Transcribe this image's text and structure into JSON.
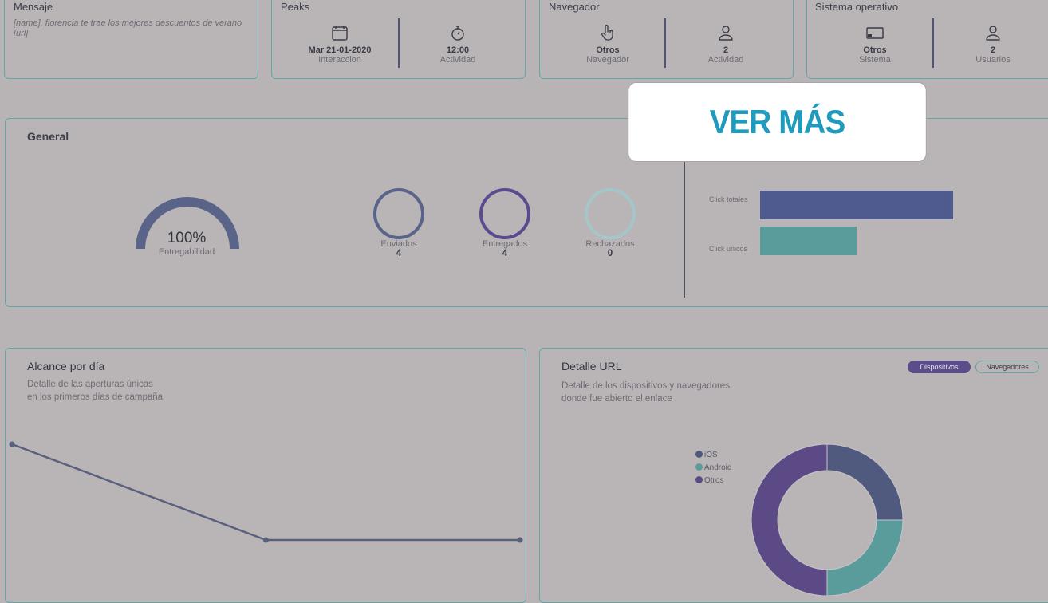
{
  "mensaje": {
    "title": "Mensaje",
    "text": "[name], florencia te trae los mejores descuentos de verano [url]"
  },
  "peaks": {
    "title": "Peaks",
    "left": {
      "icon": "calendar-icon",
      "value": "Mar 21-01-2020",
      "label": "Interaccion"
    },
    "right": {
      "icon": "stopwatch-icon",
      "value": "12:00",
      "label": "Actividad"
    }
  },
  "navegador": {
    "title": "Navegador",
    "left": {
      "icon": "pointer-hand-icon",
      "value": "Otros",
      "label": "Navegador"
    },
    "right": {
      "icon": "user-icon",
      "value": "2",
      "label": "Actividad"
    }
  },
  "sistema": {
    "title": "Sistema operativo",
    "left": {
      "icon": "cast-screen-icon",
      "value": "Otros",
      "label": "Sistema"
    },
    "right": {
      "icon": "user-icon",
      "value": "2",
      "label": "Usuarios"
    }
  },
  "general": {
    "title": "General",
    "gauge": {
      "value": "100%",
      "label": "Entregabilidad",
      "fraction": 1.0
    },
    "rings": [
      {
        "label": "Enviados",
        "value": "4",
        "color": "#5a6488"
      },
      {
        "label": "Entregados",
        "value": "4",
        "color": "#5b4a8e"
      },
      {
        "label": "Rechazados",
        "value": "0",
        "color": "#a5c6c8"
      }
    ],
    "clicks": [
      {
        "label": "Click totales",
        "value": 2,
        "color": "#4f5a8e"
      },
      {
        "label": "Click unicos",
        "value": 1,
        "color": "#5a9c9c"
      }
    ]
  },
  "overlay": {
    "cta_label": "VER MÁS"
  },
  "alcance": {
    "title": "Alcance por día",
    "description_line1": "Detalle de las aperturas únicas",
    "description_line2": "en los primeros días de campaña"
  },
  "chart_data": {
    "type": "line",
    "title": "Alcance por día",
    "xlabel": "",
    "ylabel": "",
    "x": [
      1,
      2,
      3
    ],
    "series": [
      {
        "values": [
          2,
          0,
          0
        ]
      }
    ],
    "color": "#58607e"
  },
  "detalle": {
    "title": "Detalle URL",
    "description_line1": "Detalle de los dispositivos y navegadores",
    "description_line2": "donde fue abierto el enlace",
    "tabs": [
      {
        "label": "Dispositivos",
        "active": true
      },
      {
        "label": "Navegadores",
        "active": false
      }
    ],
    "legend": [
      {
        "label": "iOS",
        "color": "#4f5a7e"
      },
      {
        "label": "Android",
        "color": "#5a9c9c"
      },
      {
        "label": "Otros",
        "color": "#5b4a86"
      }
    ],
    "donut": [
      {
        "label": "iOS",
        "fraction": 0.25,
        "color": "#4f5a7e"
      },
      {
        "label": "Android",
        "fraction": 0.25,
        "color": "#5a9c9c"
      },
      {
        "label": "Otros",
        "fraction": 0.5,
        "color": "#5b4a86"
      }
    ]
  }
}
